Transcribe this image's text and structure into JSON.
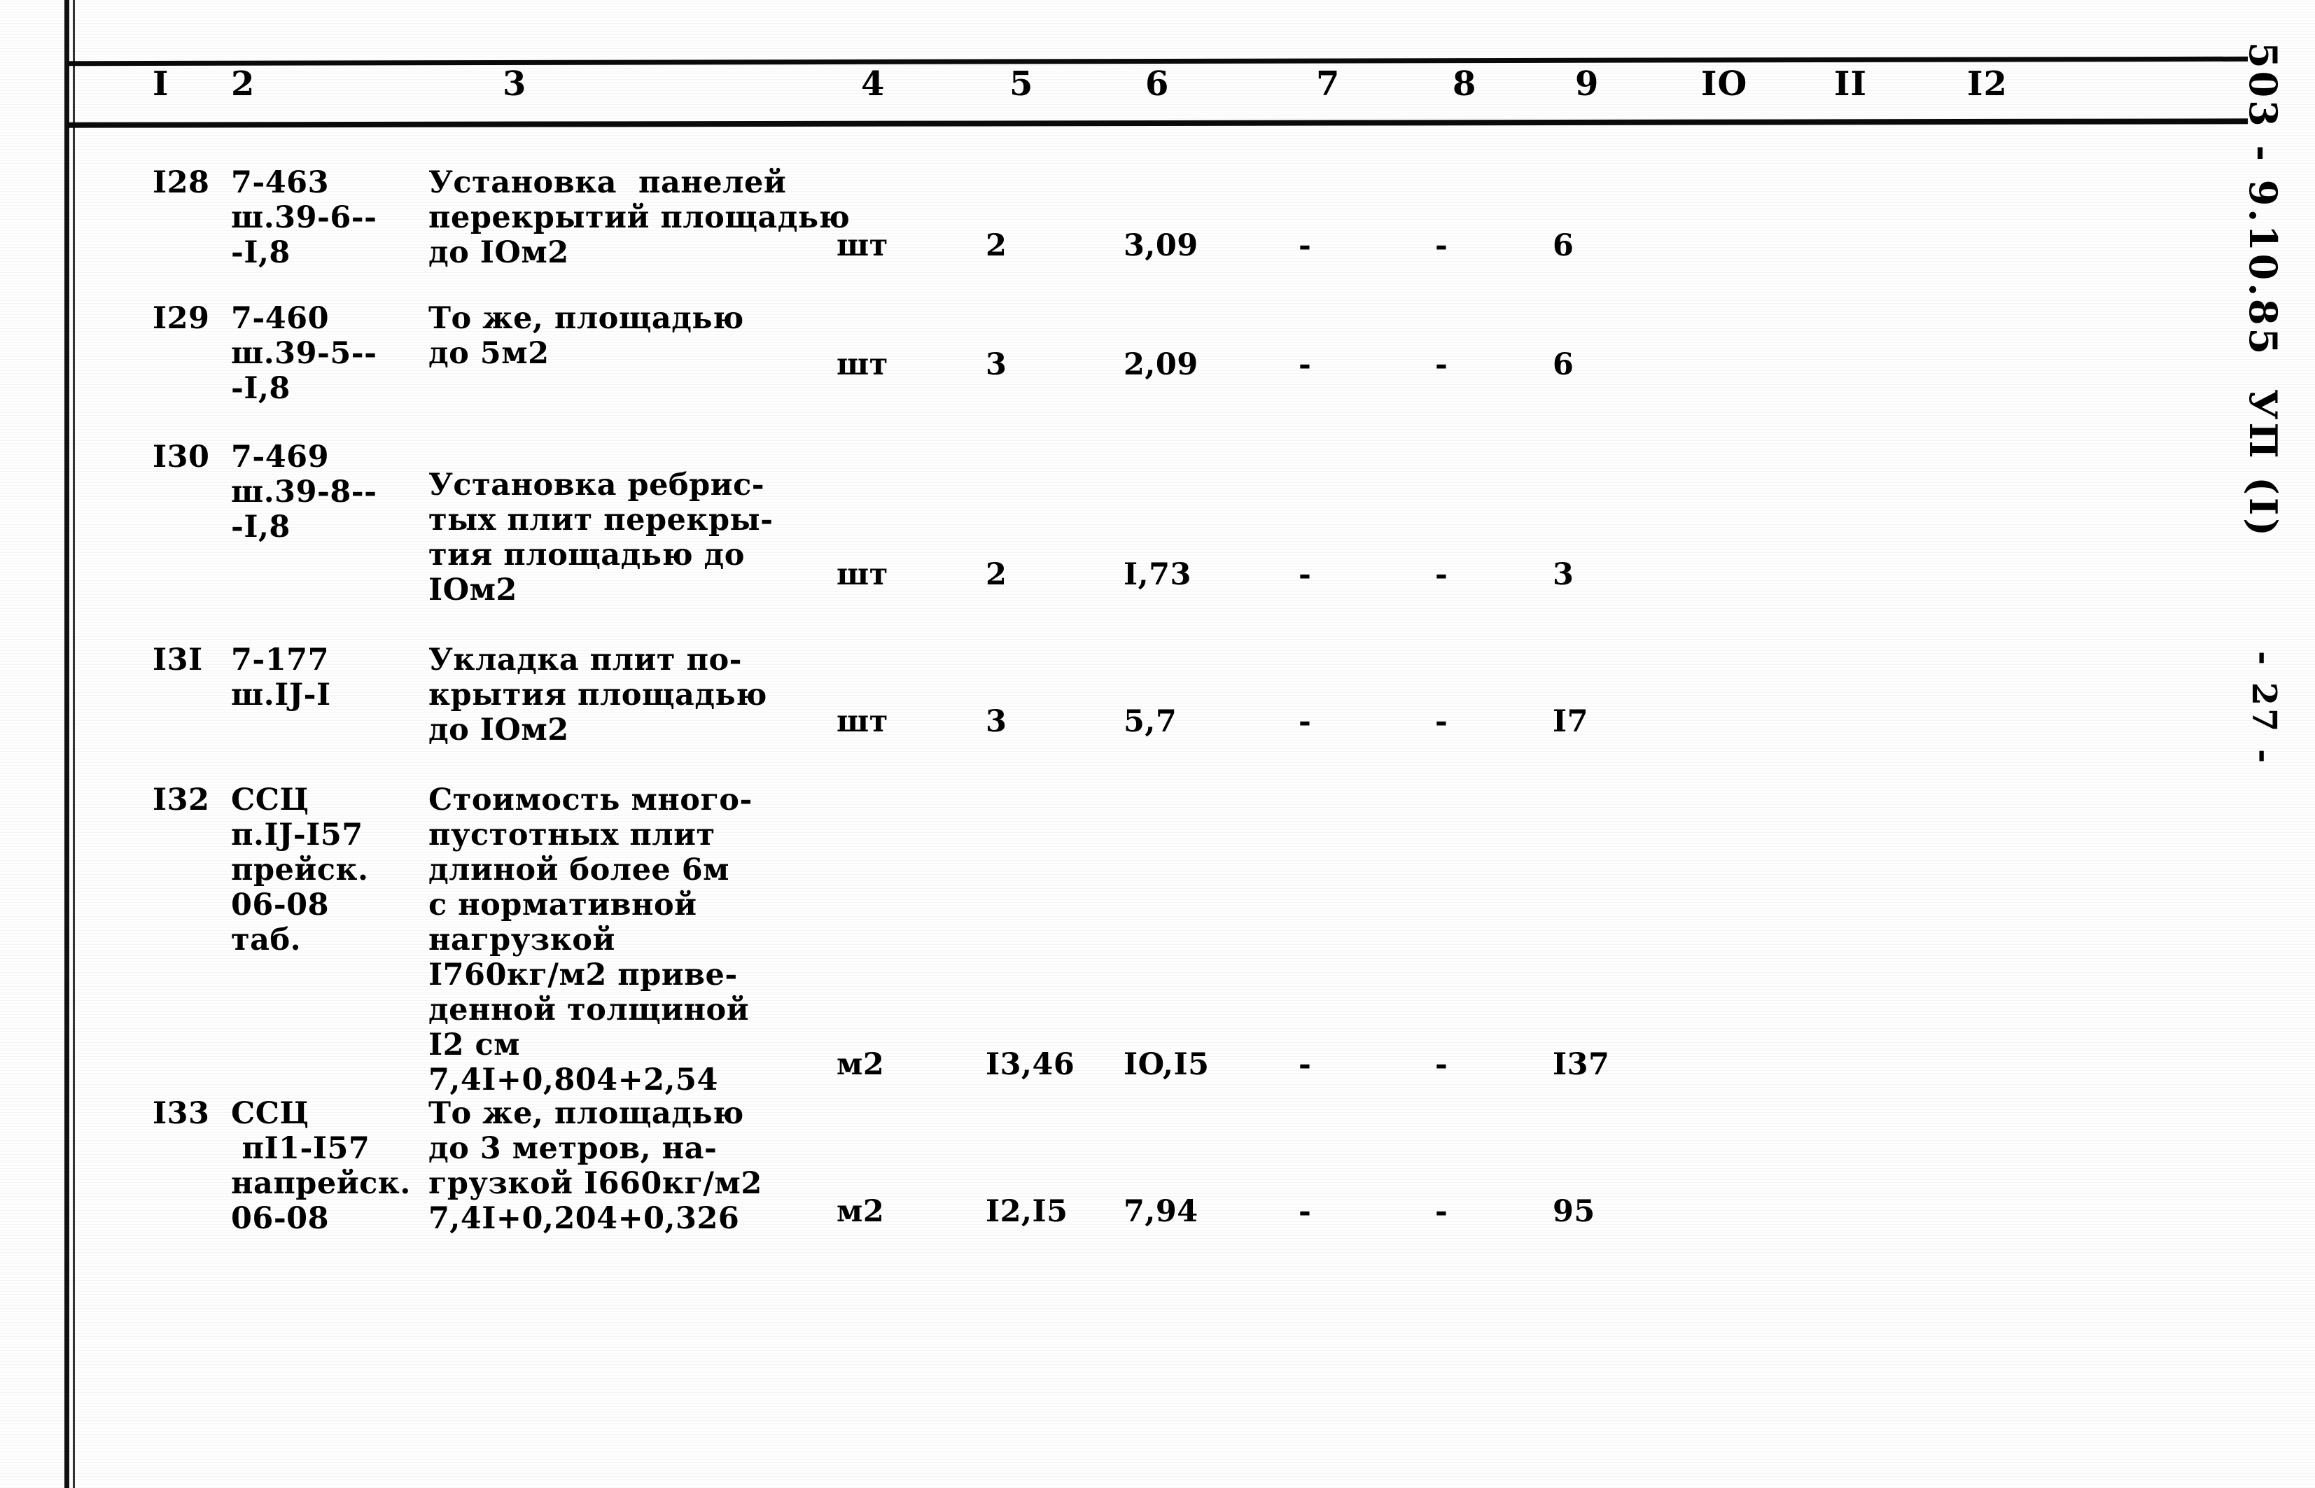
{
  "document": {
    "side_stamp_code": "503 - 9.10.85  УП (I)",
    "side_stamp_page": "- 27 -"
  },
  "table": {
    "column_headers": [
      "I",
      "2",
      "3",
      "4",
      "5",
      "6",
      "7",
      "8",
      "9",
      "IO",
      "II",
      "I2"
    ],
    "rows": [
      {
        "no": "I28",
        "code": "7-463\nш.39-6--\n-I,8",
        "desc": "Установка  панелей\nперекрытий площадью\nдо IOм2",
        "unit": "шт",
        "qty": "2",
        "c6": "3,09",
        "c7": "-",
        "c8": "-",
        "c9": "6"
      },
      {
        "no": "I29",
        "code": "7-460\nш.39-5--\n-I,8",
        "desc": "То же, площадью\nдо 5м2",
        "unit": "шт",
        "qty": "3",
        "c6": "2,09",
        "c7": "-",
        "c8": "-",
        "c9": "6"
      },
      {
        "no": "I30",
        "code": "7-469\nш.39-8--\n-I,8",
        "desc": "Установка ребрис-\nтых плит перекры-\nтия площадью до\nIOм2",
        "unit": "шт",
        "qty": "2",
        "c6": "I,73",
        "c7": "-",
        "c8": "-",
        "c9": "3"
      },
      {
        "no": "I3I",
        "code": "7-177\nш.IJ-I",
        "desc": "Укладка плит по-\nкрытия площадью\nдо IOм2",
        "unit": "шт",
        "qty": "3",
        "c6": "5,7",
        "c7": "-",
        "c8": "-",
        "c9": "I7"
      },
      {
        "no": "I32",
        "code": "ССЦ\nп.IJ-I57\nпрейск.\n06-08\nтаб.",
        "desc": "Стоимость много-\nпустотных плит\nдлиной более 6м\nс нормативной\nнагрузкой\nI760кг/м2 приве-\nденной толщиной\nI2 см\n7,4I+0,804+2,54",
        "unit": "м2",
        "qty": "I3,46",
        "c6": "IO,I5",
        "c7": "-",
        "c8": "-",
        "c9": "I37"
      },
      {
        "no": "I33",
        "code": "ССЦ\n пI1-I57\nнапрейск.\n06-08",
        "desc": "То же, площадью\nдо 3 метров, на-\nгрузкой I660кг/м2\n7,4I+0,204+0,326",
        "unit": "м2",
        "qty": "I2,I5",
        "c6": "7,94",
        "c7": "-",
        "c8": "-",
        "c9": "95"
      }
    ]
  },
  "layout": {
    "header_x": [
      218,
      330,
      718,
      1230,
      1442,
      1636,
      1880,
      2075,
      2250,
      2430,
      2620,
      2810
    ],
    "row_top": [
      236,
      430,
      628,
      918,
      1118,
      1566
    ],
    "row_values_y": [
      326,
      496,
      796,
      1006,
      1496,
      1706
    ],
    "code_top": [
      236,
      430,
      628,
      918,
      1118,
      1566
    ],
    "desc_top": [
      236,
      430,
      668,
      918,
      1118,
      1566
    ]
  }
}
